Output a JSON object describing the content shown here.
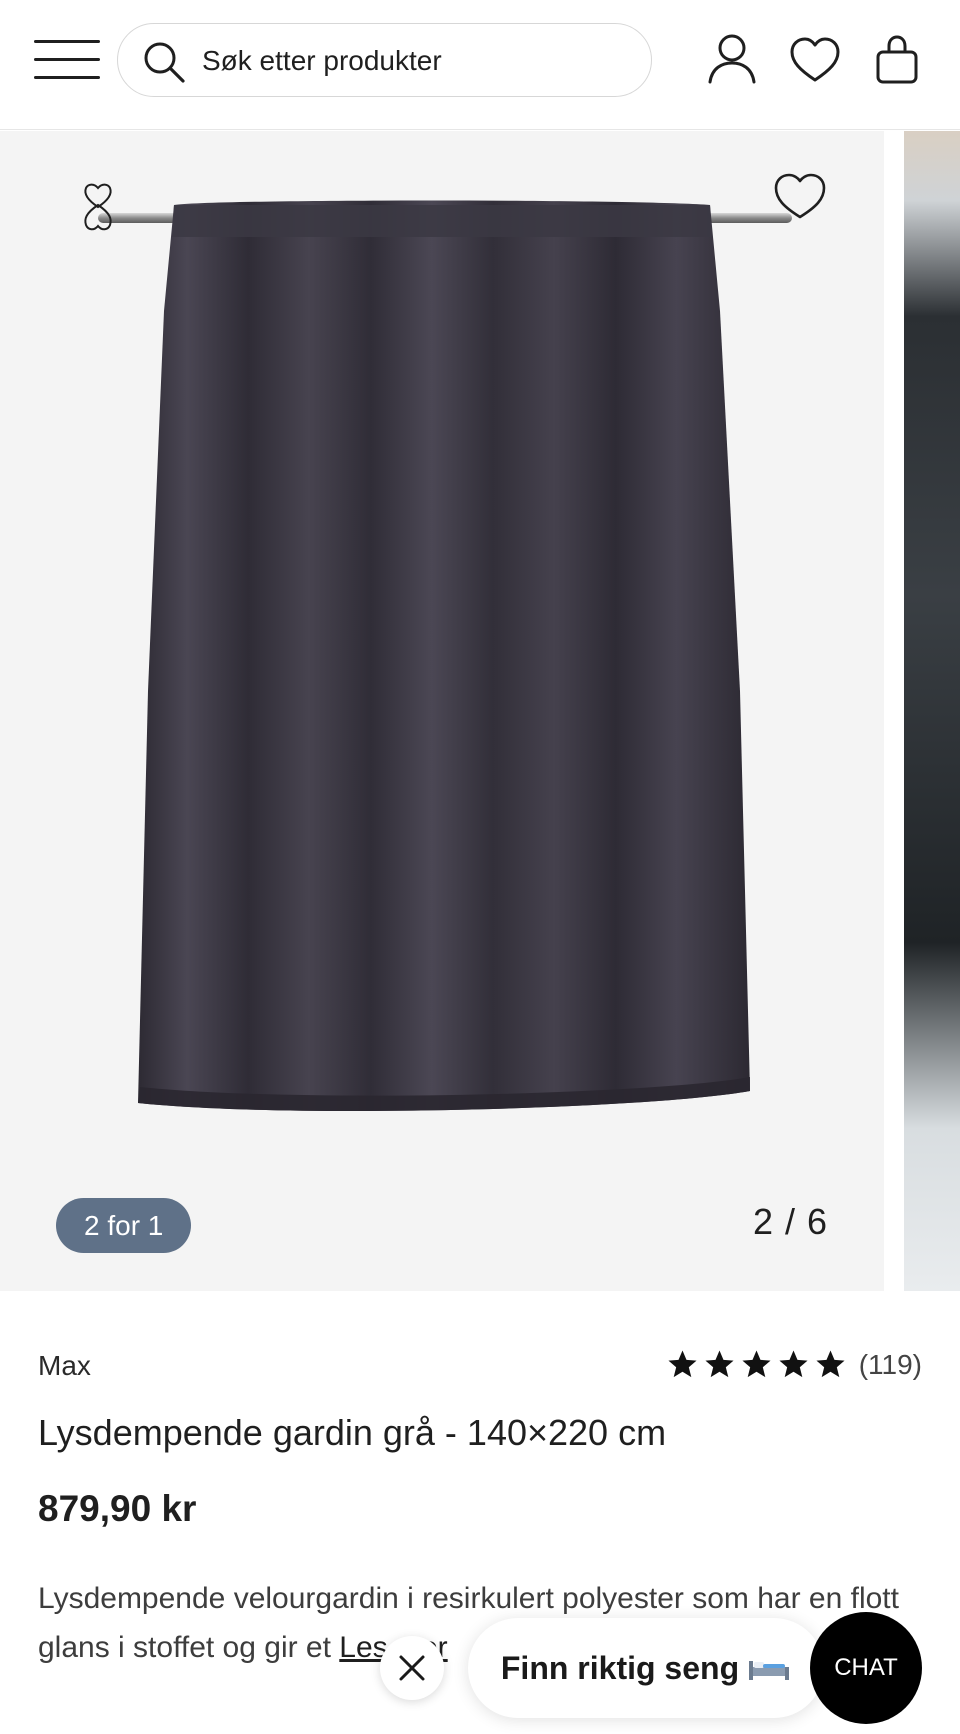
{
  "header": {
    "search_placeholder": "Søk etter produkter"
  },
  "gallery": {
    "badge": "2 for 1",
    "counter": "2 / 6"
  },
  "product": {
    "brand": "Max",
    "rating_stars": 5,
    "rating_count": "(119)",
    "title": "Lysdempende gardin grå - 140×220 cm",
    "price": "879,90 kr",
    "description": "Lysdempende velourgardin i resirkulert polyester som har en flott glans i stoffet og gir et ",
    "read_more": "Les mer"
  },
  "floating": {
    "promo_label": "Finn riktig seng",
    "promo_icon": "bed-icon",
    "chat_label": "CHAT"
  },
  "colors": {
    "badge_bg": "#5f7188",
    "curtain": "#3a3742",
    "chat_bg": "#000000"
  }
}
